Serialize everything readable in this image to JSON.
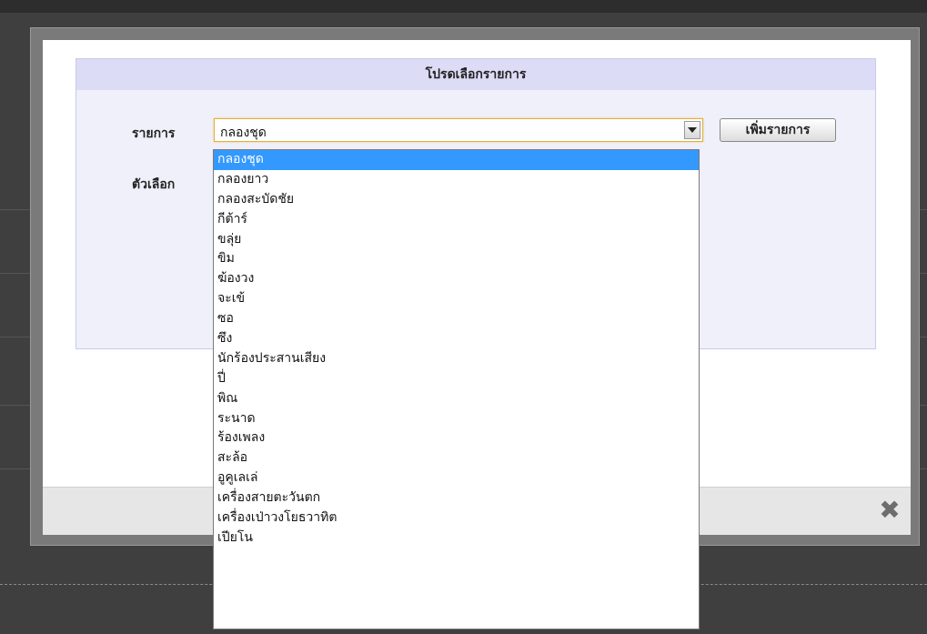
{
  "dialog": {
    "title": "โปรดเลือกรายการ",
    "item_label": "รายการ",
    "option_label": "ตัวเลือก",
    "selected_value": "กลองชุด",
    "add_button": "เพิ่มรายการ",
    "close_icon": "close-icon"
  },
  "dropdown": {
    "options": [
      "กลองชุด",
      "กลองยาว",
      "กลองสะบัดชัย",
      "กีต้าร์",
      "ขลุ่ย",
      "ขิม",
      "ฆ้องวง",
      "จะเข้",
      "ซอ",
      "ซึง",
      "นักร้องประสานเสียง",
      "ปี่",
      "พิณ",
      "ระนาด",
      "ร้องเพลง",
      "สะล้อ",
      "อูคูเลเล่",
      "เครื่องสายตะวันตก",
      "เครื่องเป่าวงโยธวาทิต",
      "เปียโน"
    ],
    "highlighted_index": 0
  },
  "colors": {
    "panel_header": "#dcdcf7",
    "highlight": "#3399ff",
    "overlay": "#3f3f3f"
  }
}
